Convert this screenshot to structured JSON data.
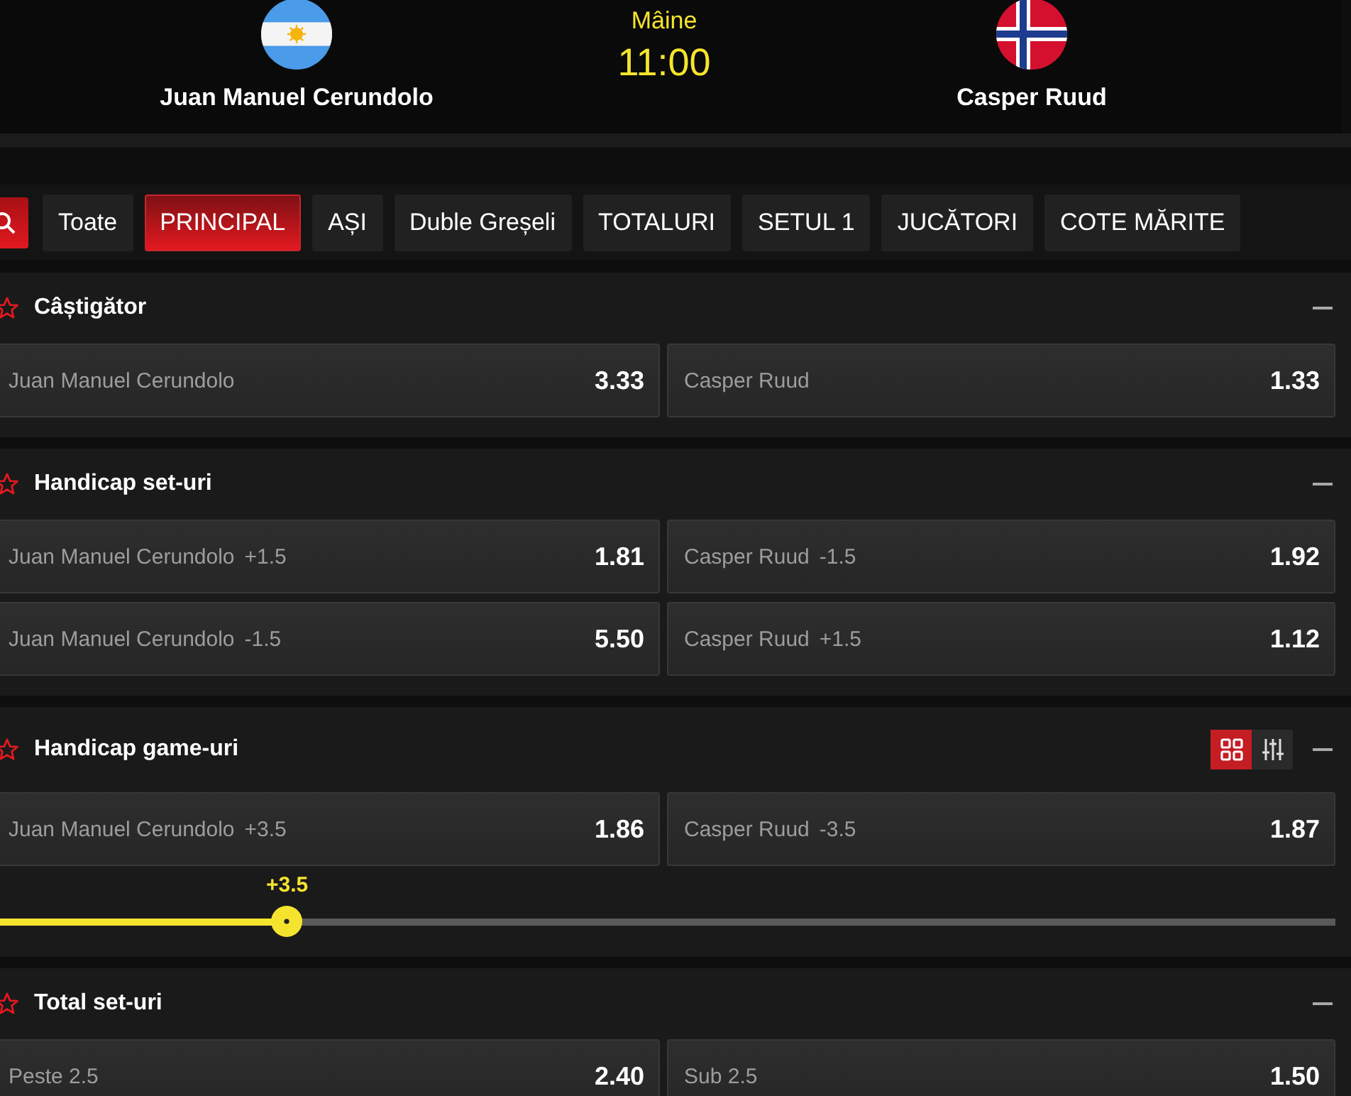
{
  "match": {
    "date": "Mâine",
    "time": "11:00",
    "players": [
      {
        "name": "Juan Manuel Cerundolo"
      },
      {
        "name": "Casper Ruud"
      }
    ]
  },
  "tabs": [
    {
      "label": "Toate",
      "selected": false
    },
    {
      "label": "PRINCIPAL",
      "selected": true
    },
    {
      "label": "AȘI",
      "selected": false
    },
    {
      "label": "Duble Greșeli",
      "selected": false
    },
    {
      "label": "TOTALURI",
      "selected": false
    },
    {
      "label": "SETUL 1",
      "selected": false
    },
    {
      "label": "JUCĂTORI",
      "selected": false
    },
    {
      "label": "COTE MĂRITE",
      "selected": false
    }
  ],
  "markets": [
    {
      "title": "Câștigător",
      "rows": [
        [
          {
            "name": "Juan Manuel Cerundolo",
            "odds": "3.33"
          },
          {
            "name": "Casper Ruud",
            "odds": "1.33"
          }
        ]
      ]
    },
    {
      "title": "Handicap set-uri",
      "rows": [
        [
          {
            "name": "Juan Manuel Cerundolo",
            "line": "+1.5",
            "odds": "1.81"
          },
          {
            "name": "Casper Ruud",
            "line": "-1.5",
            "odds": "1.92"
          }
        ],
        [
          {
            "name": "Juan Manuel Cerundolo",
            "line": "-1.5",
            "odds": "5.50"
          },
          {
            "name": "Casper Ruud",
            "line": "+1.5",
            "odds": "1.12"
          }
        ]
      ]
    },
    {
      "title": "Handicap game-uri",
      "views": [
        {
          "kind": "grid",
          "selected": true
        },
        {
          "kind": "sliders",
          "selected": false
        }
      ],
      "rows": [
        [
          {
            "name": "Juan Manuel Cerundolo",
            "line": "+3.5",
            "odds": "1.86"
          },
          {
            "name": "Casper Ruud",
            "line": "-3.5",
            "odds": "1.87"
          }
        ]
      ],
      "slider": {
        "label": "+3.5",
        "level": 0.22
      }
    },
    {
      "title": "Total set-uri",
      "rows": [
        [
          {
            "name": "Peste 2.5",
            "odds": "2.40"
          },
          {
            "name": "Sub 2.5",
            "odds": "1.50"
          }
        ]
      ]
    }
  ]
}
